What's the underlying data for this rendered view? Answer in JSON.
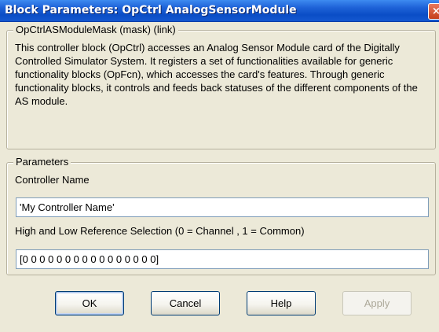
{
  "window": {
    "title": "Block Parameters: OpCtrl AnalogSensorModule",
    "close_glyph": "×"
  },
  "mask_group": {
    "legend": "OpCtrlASModuleMask (mask) (link)",
    "description": "This controller block (OpCtrl) accesses an Analog Sensor Module card of the Digitally Controlled Simulator System. It registers a set of functionalities available for generic functionality blocks (OpFcn), which accesses the card's features. Through generic functionality blocks, it controls and feeds back statuses of the different components of the AS module."
  },
  "parameters": {
    "legend": "Parameters",
    "controller_name": {
      "label": "Controller Name",
      "value": "'My Controller Name'"
    },
    "reference_selection": {
      "label": "High and Low Reference Selection (0 = Channel , 1 = Common)",
      "value": "[0 0 0 0 0 0 0 0 0 0 0 0 0 0 0 0]"
    }
  },
  "buttons": {
    "ok": "OK",
    "cancel": "Cancel",
    "help": "Help",
    "apply": "Apply"
  }
}
